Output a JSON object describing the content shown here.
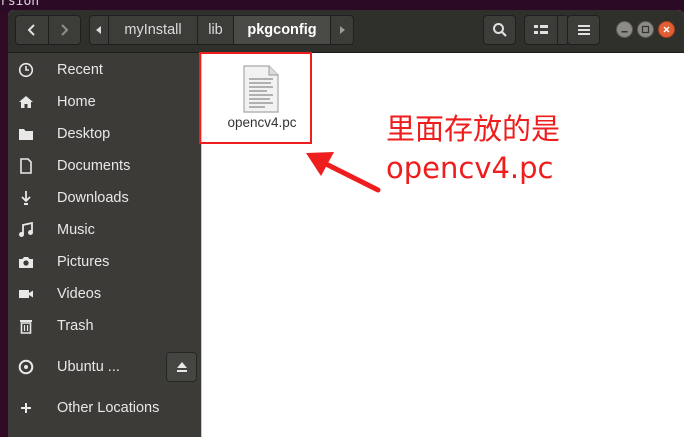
{
  "terminal": {
    "visible_text": "rsion"
  },
  "toolbar": {
    "back_label": "back",
    "forward_label": "forward",
    "path_segments": [
      {
        "label": "myInstall"
      },
      {
        "label": "lib"
      },
      {
        "label": "pkgconfig",
        "active": true
      }
    ]
  },
  "sidebar": {
    "items": [
      {
        "label": "Recent",
        "icon": "clock-icon"
      },
      {
        "label": "Home",
        "icon": "home-icon"
      },
      {
        "label": "Desktop",
        "icon": "desktop-folder-icon"
      },
      {
        "label": "Documents",
        "icon": "document-icon"
      },
      {
        "label": "Downloads",
        "icon": "download-icon"
      },
      {
        "label": "Music",
        "icon": "music-icon"
      },
      {
        "label": "Pictures",
        "icon": "camera-icon"
      },
      {
        "label": "Videos",
        "icon": "video-icon"
      },
      {
        "label": "Trash",
        "icon": "trash-icon"
      },
      {
        "label": "Ubuntu ...",
        "icon": "disc-icon"
      },
      {
        "label": "Other Locations",
        "icon": "plus-icon"
      }
    ]
  },
  "files": [
    {
      "name": "opencv4.pc",
      "icon": "text-file-icon"
    }
  ],
  "annotation": {
    "line1": "里面存放的是",
    "line2": "opencv4.pc",
    "color": "#ee1e1e"
  },
  "colors": {
    "headerbar": "#2f2f2c",
    "sidebar": "#3c3b37",
    "close_button": "#e05f34"
  }
}
